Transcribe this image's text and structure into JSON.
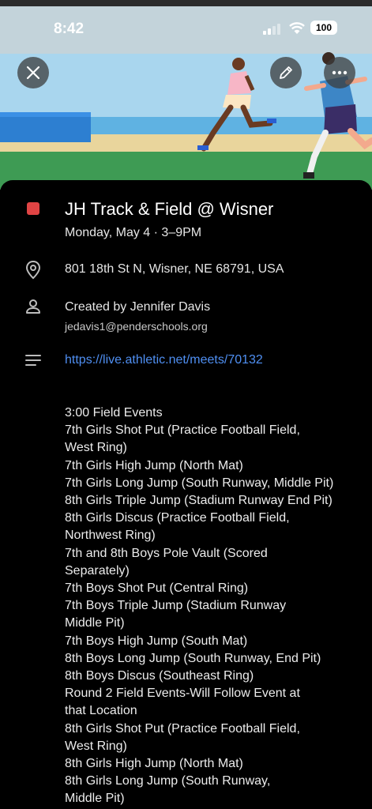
{
  "status_bar": {
    "time": "8:42",
    "battery": "100"
  },
  "event": {
    "color": "#e04444",
    "title": "JH Track & Field @ Wisner",
    "datetime": "Monday, May 4 · 3–9PM",
    "location": "801 18th St N, Wisner, NE 68791, USA",
    "created_by": "Created by Jennifer Davis",
    "creator_email": "jedavis1@penderschools.org",
    "link": "https://live.athletic.net/meets/70132",
    "description_lines": [
      "3:00 Field Events",
      "7th Girls Shot Put (Practice Football Field,",
      "West Ring)",
      "7th Girls High Jump (North Mat)",
      "7th Girls Long Jump (South Runway, Middle Pit)",
      "8th Girls Triple Jump (Stadium Runway End Pit)",
      "8th Girls Discus (Practice Football Field,",
      "Northwest Ring)",
      "7th and 8th Boys Pole Vault (Scored",
      "Separately)",
      "7th Boys Shot Put (Central Ring)",
      "7th Boys Triple Jump (Stadium Runway",
      "Middle Pit)",
      "7th Boys High Jump (South Mat)",
      "8th Boys Long Jump (South Runway, End Pit)",
      "8th Boys Discus (Southeast Ring)",
      "Round 2 Field Events-Will Follow Event at",
      "that Location",
      "8th Girls Shot Put (Practice Football Field,",
      "West Ring)",
      "8th Girls High Jump (North Mat)",
      "8th Girls Long Jump (South Runway,",
      "Middle Pit)"
    ]
  },
  "icons": {
    "close": "close-icon",
    "edit": "pencil-icon",
    "more": "more-horizontal-icon",
    "location": "location-pin-icon",
    "person": "person-icon",
    "notes": "notes-icon"
  }
}
